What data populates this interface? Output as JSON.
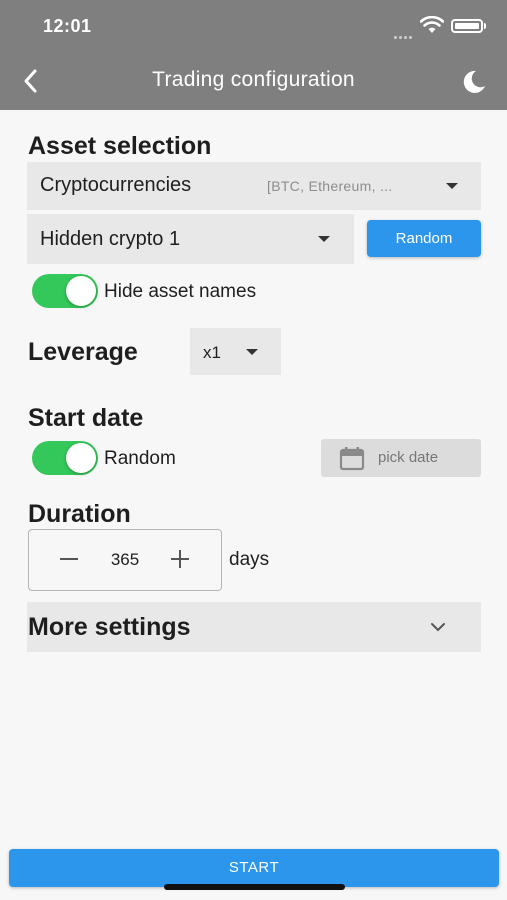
{
  "status_bar": {
    "time": "12:01"
  },
  "app_bar": {
    "title": "Trading configuration"
  },
  "asset_selection": {
    "title": "Asset selection",
    "category": {
      "value": "Cryptocurrencies",
      "hint": "[BTC, Ethereum, ..."
    },
    "asset": {
      "value": "Hidden crypto 1"
    },
    "random_label": "Random",
    "hide_names": {
      "label": "Hide asset names",
      "on": true
    }
  },
  "leverage": {
    "title": "Leverage",
    "value": "x1"
  },
  "start_date": {
    "title": "Start date",
    "random": {
      "label": "Random",
      "on": true
    },
    "pick_date_label": "pick date"
  },
  "duration": {
    "title": "Duration",
    "value": "365",
    "unit": "days"
  },
  "more_settings": {
    "title": "More settings"
  },
  "start_label": "START",
  "colors": {
    "accent": "#2c95ec",
    "toggle_on": "#34c759",
    "app_bar": "#7f7f7f"
  }
}
